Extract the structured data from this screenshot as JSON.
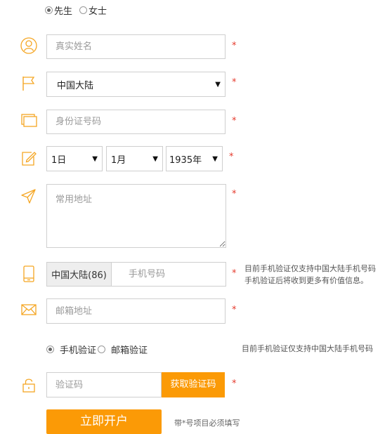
{
  "gender": {
    "male_label": "先生",
    "female_label": "女士",
    "selected": "male"
  },
  "name_field": {
    "placeholder": "真实姓名",
    "required_mark": "*"
  },
  "region_select": {
    "value": "中国大陆",
    "required_mark": "*"
  },
  "id_field": {
    "placeholder": "身份证号码",
    "required_mark": "*"
  },
  "birthday": {
    "day": "1日",
    "month": "1月",
    "year": "1935年",
    "required_mark": "*"
  },
  "address_field": {
    "placeholder": "常用地址",
    "required_mark": "*"
  },
  "phone": {
    "prefix": "中国大陆(86)",
    "placeholder": "手机号码",
    "required_mark": "*",
    "hint_line1": "目前手机验证仅支持中国大陆手机号码",
    "hint_line2": "手机验证后将收到更多有价值信息。"
  },
  "email_field": {
    "placeholder": "邮箱地址",
    "required_mark": "*"
  },
  "verify_method": {
    "phone_label": "手机验证",
    "email_label": "邮箱验证",
    "selected": "phone",
    "hint": "目前手机验证仅支持中国大陆手机号码"
  },
  "code": {
    "placeholder": "验证码",
    "get_code_label": "获取验证码",
    "required_mark": "*"
  },
  "submit": {
    "label": "立即开户",
    "note": "带*号项目必须填写"
  },
  "colors": {
    "accent": "#fb9a06",
    "icon": "#f5a623",
    "required": "#e53a2c",
    "border": "#cfcfcf"
  }
}
